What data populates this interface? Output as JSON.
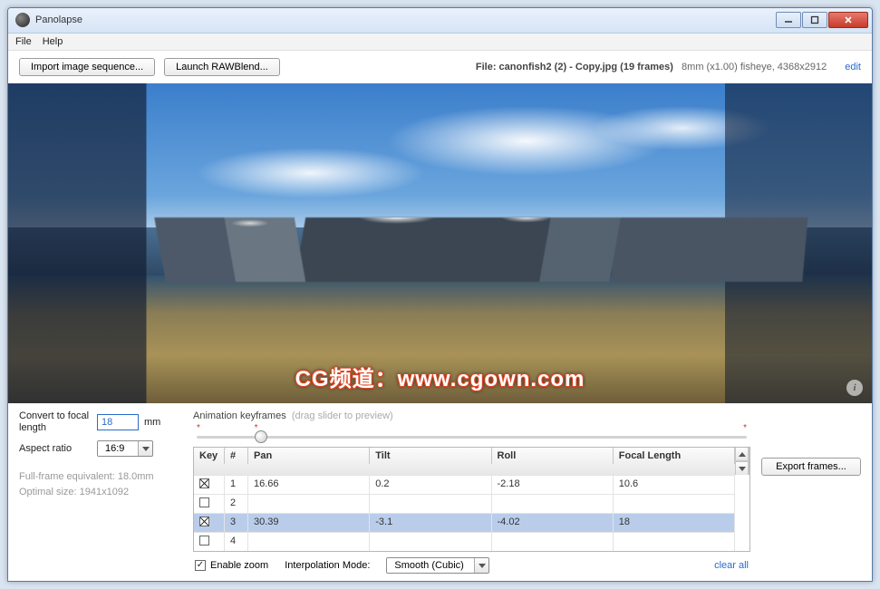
{
  "window": {
    "title": "Panolapse"
  },
  "menu": {
    "file": "File",
    "help": "Help"
  },
  "toolbar": {
    "import_label": "Import image sequence...",
    "launch_label": "Launch RAWBlend...",
    "file_prefix": "File: ",
    "file_name": "canonfish2 (2) - Copy.jpg (19 frames)",
    "file_meta": "8mm (x1.00) fisheye, 4368x2912",
    "edit_label": "edit"
  },
  "watermark": "CG频道：www.cgown.com",
  "left": {
    "convert_label": "Convert to focal length",
    "convert_value": "18",
    "convert_unit": "mm",
    "aspect_label": "Aspect ratio",
    "aspect_value": "16:9",
    "hint1": "Full-frame equivalent: 18.0mm",
    "hint2": "Optimal size: 1941x1092"
  },
  "kf": {
    "title": "Animation keyframes",
    "subtitle": "(drag slider to preview)",
    "cols": {
      "key": "Key",
      "num": "#",
      "pan": "Pan",
      "tilt": "Tilt",
      "roll": "Roll",
      "fl": "Focal Length"
    },
    "rows": [
      {
        "key": true,
        "num": "1",
        "pan": "16.66",
        "tilt": "0.2",
        "roll": "-2.18",
        "fl": "10.6"
      },
      {
        "key": false,
        "num": "2",
        "pan": "",
        "tilt": "",
        "roll": "",
        "fl": ""
      },
      {
        "key": true,
        "num": "3",
        "pan": "30.39",
        "tilt": "-3.1",
        "roll": "-4.02",
        "fl": "18"
      },
      {
        "key": false,
        "num": "4",
        "pan": "",
        "tilt": "",
        "roll": "",
        "fl": ""
      }
    ],
    "selected_index": 2,
    "enable_zoom_label": "Enable zoom",
    "enable_zoom": true,
    "interp_label": "Interpolation Mode:",
    "interp_value": "Smooth (Cubic)",
    "clear_label": "clear all"
  },
  "export_label": "Export frames..."
}
